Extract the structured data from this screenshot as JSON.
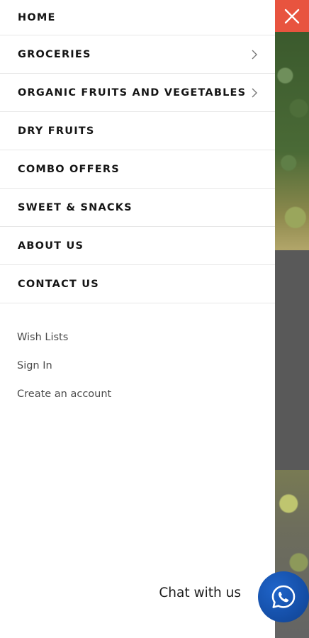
{
  "close_button": {
    "icon": "close-icon",
    "color": "#e8543f"
  },
  "menu": {
    "items": [
      {
        "label": "HOME",
        "has_submenu": false
      },
      {
        "label": "GROCERIES",
        "has_submenu": true
      },
      {
        "label": "ORGANIC FRUITS AND VEGETABLES",
        "has_submenu": true
      },
      {
        "label": "DRY FRUITS",
        "has_submenu": false
      },
      {
        "label": "COMBO OFFERS",
        "has_submenu": false
      },
      {
        "label": "SWEET & SNACKS",
        "has_submenu": false
      },
      {
        "label": "ABOUT US",
        "has_submenu": false
      },
      {
        "label": "CONTACT US",
        "has_submenu": false
      }
    ]
  },
  "account_links": [
    {
      "label": "Wish Lists"
    },
    {
      "label": "Sign In"
    },
    {
      "label": "Create an account"
    }
  ],
  "chat": {
    "label": "Chat with us",
    "icon": "whatsapp-icon",
    "color": "#154fa8"
  }
}
